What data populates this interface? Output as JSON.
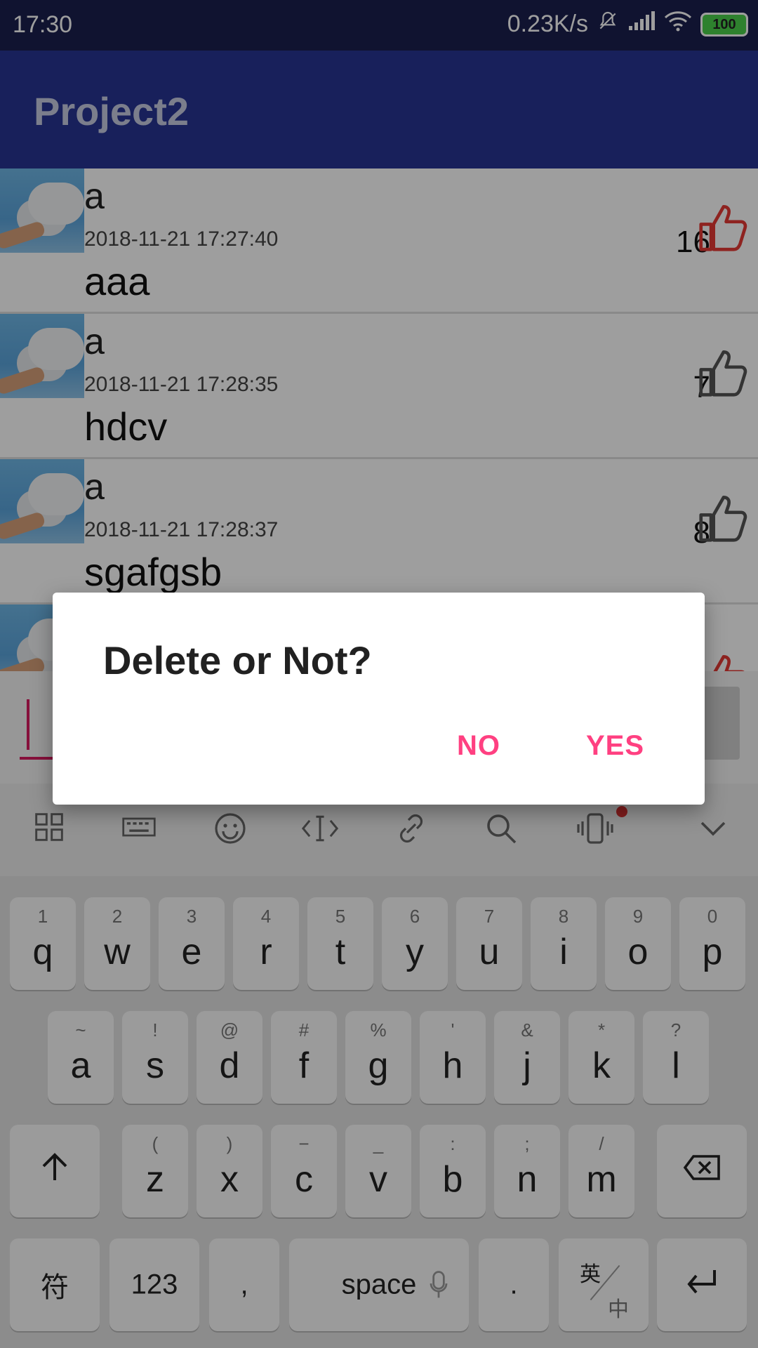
{
  "status_bar": {
    "time": "17:30",
    "speed": "0.23K/s",
    "battery": "100",
    "icons": [
      "bell-off-icon",
      "signal-icon",
      "wifi-icon",
      "battery-icon"
    ]
  },
  "app_bar": {
    "title": "Project2"
  },
  "posts": [
    {
      "name": "a",
      "timestamp": "2018-11-21 17:27:40",
      "content": "aaa",
      "likes": "16",
      "liked": true
    },
    {
      "name": "a",
      "timestamp": "2018-11-21 17:28:35",
      "content": "hdcv",
      "likes": "7",
      "liked": false
    },
    {
      "name": "a",
      "timestamp": "2018-11-21 17:28:37",
      "content": "sgafgsb",
      "likes": "8",
      "liked": false
    },
    {
      "name": "",
      "timestamp": "",
      "content": "",
      "likes": "",
      "liked": true
    }
  ],
  "dialog": {
    "title": "Delete or Not?",
    "no_label": "NO",
    "yes_label": "YES"
  },
  "keyboard": {
    "row1": [
      {
        "main": "q",
        "sub": "1"
      },
      {
        "main": "w",
        "sub": "2"
      },
      {
        "main": "e",
        "sub": "3"
      },
      {
        "main": "r",
        "sub": "4"
      },
      {
        "main": "t",
        "sub": "5"
      },
      {
        "main": "y",
        "sub": "6"
      },
      {
        "main": "u",
        "sub": "7"
      },
      {
        "main": "i",
        "sub": "8"
      },
      {
        "main": "o",
        "sub": "9"
      },
      {
        "main": "p",
        "sub": "0"
      }
    ],
    "row2": [
      {
        "main": "a",
        "sub": "~"
      },
      {
        "main": "s",
        "sub": "!"
      },
      {
        "main": "d",
        "sub": "@"
      },
      {
        "main": "f",
        "sub": "#"
      },
      {
        "main": "g",
        "sub": "%"
      },
      {
        "main": "h",
        "sub": "'"
      },
      {
        "main": "j",
        "sub": "&"
      },
      {
        "main": "k",
        "sub": "*"
      },
      {
        "main": "l",
        "sub": "?"
      }
    ],
    "row3": [
      {
        "main": "z",
        "sub": "("
      },
      {
        "main": "x",
        "sub": ")"
      },
      {
        "main": "c",
        "sub": "−"
      },
      {
        "main": "v",
        "sub": "_"
      },
      {
        "main": "b",
        "sub": ":"
      },
      {
        "main": "n",
        "sub": ";"
      },
      {
        "main": "m",
        "sub": "/"
      }
    ],
    "symbols_label": "符",
    "numbers_label": "123",
    "comma_label": ",",
    "space_label": "space",
    "period_label": ".",
    "lang_label_top": "英",
    "lang_label_bottom": "中"
  },
  "colors": {
    "status_bar": "#1a1f4e",
    "app_bar": "#283593",
    "accent": "#ff4081",
    "like_active": "#e53935"
  }
}
